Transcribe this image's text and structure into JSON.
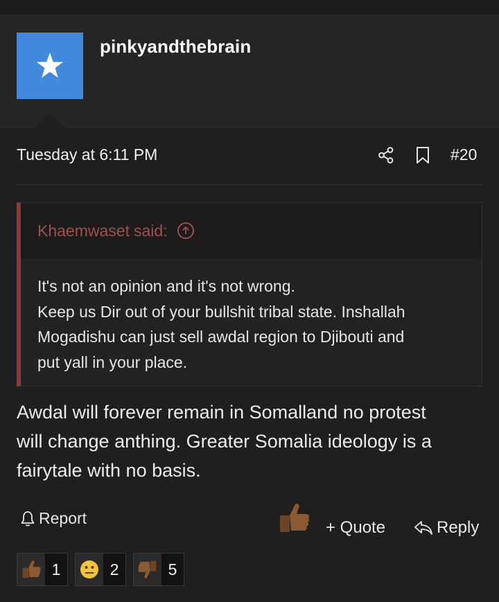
{
  "author": {
    "username": "pinkyandthebrain",
    "avatar_icon": "star-icon",
    "avatar_color": "#4189dd"
  },
  "post": {
    "timestamp": "Tuesday at 6:11 PM",
    "number": "#20",
    "body_lines": [
      "Awdal will forever remain in Somalland no protest",
      "will change anthing. Greater Somalia ideology is a",
      "fairytale with no basis."
    ]
  },
  "quote": {
    "author": "Khaemwaset",
    "said_label": "said:",
    "lines": [
      "It's not an opinion and it's not wrong.",
      "Keep us Dir out of your bullshit tribal state. Inshallah",
      "Mogadishu can just sell awdal region to Djibouti and",
      "put yall in your place."
    ],
    "accent_color": "#8a3a3a"
  },
  "actions": {
    "report_label": "Report",
    "quote_label": "+ Quote",
    "reply_label": "Reply"
  },
  "reactions": [
    {
      "icon": "thumbs-up-icon",
      "count": "1"
    },
    {
      "icon": "neutral-face-icon",
      "count": "2"
    },
    {
      "icon": "thumbs-down-icon",
      "count": "5"
    }
  ]
}
